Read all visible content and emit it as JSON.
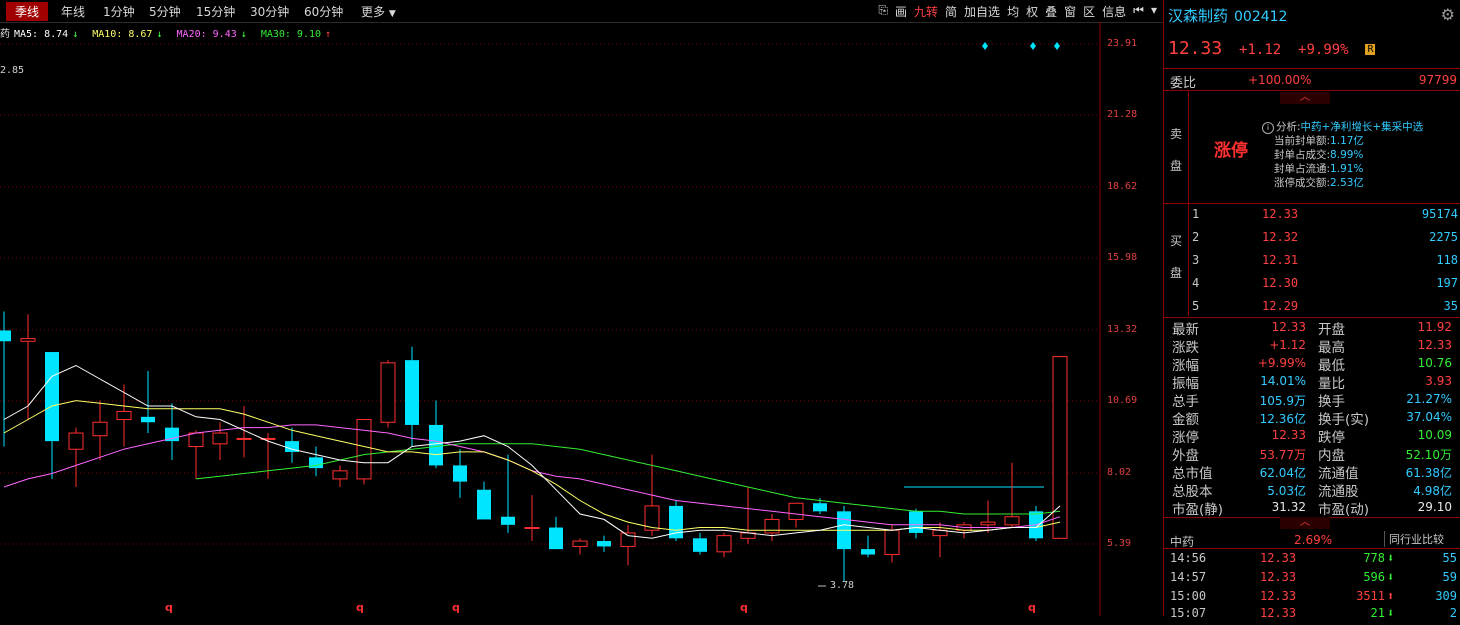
{
  "toolbar": {
    "periods": [
      "季线",
      "年线",
      "1分钟",
      "5分钟",
      "15分钟",
      "30分钟",
      "60分钟",
      "更多"
    ],
    "tools": [
      "⎘",
      "画",
      "九转",
      "简",
      "加自选",
      "均",
      "权",
      "叠",
      "窗",
      "区",
      "信息",
      "⏮",
      "▾"
    ]
  },
  "legend": {
    "prefix": "药",
    "ma5": "MA5: 8.74",
    "ma5_dir": "↓",
    "ma10": "MA10: 8.67",
    "ma10_dir": "↓",
    "ma20": "MA20: 9.43",
    "ma20_dir": "↓",
    "ma30": "MA30: 9.10",
    "ma30_dir": "↑"
  },
  "chart": {
    "high_label": "2.85",
    "low_label": "3.78",
    "axis_ticks": [
      "23.91",
      "21.28",
      "18.62",
      "15.98",
      "13.32",
      "10.69",
      "8.02",
      "5.39"
    ],
    "quarter_marks": [
      "q",
      "q",
      "q",
      "q",
      "q"
    ],
    "colors": {
      "up": "#ff3030",
      "down": "#00e5ff",
      "ma5": "#ffffff",
      "ma10": "#ffff66",
      "ma20": "#ff66ff",
      "ma30": "#33ee33",
      "grid": "#7a0000"
    }
  },
  "chart_data": {
    "type": "candlestick",
    "y_axis_ticks": [
      23.91,
      21.28,
      18.62,
      15.98,
      13.32,
      10.69,
      8.02,
      5.39
    ],
    "ylim": [
      5.39,
      23.91
    ],
    "candles": [
      {
        "o": 13.3,
        "h": 14.0,
        "l": 9.0,
        "c": 12.9
      },
      {
        "o": 12.9,
        "h": 13.9,
        "l": 10.0,
        "c": 13.0
      },
      {
        "o": 12.5,
        "h": 12.5,
        "l": 7.8,
        "c": 9.2
      },
      {
        "o": 8.9,
        "h": 9.7,
        "l": 7.5,
        "c": 9.5
      },
      {
        "o": 9.4,
        "h": 10.7,
        "l": 8.5,
        "c": 9.9
      },
      {
        "o": 10.0,
        "h": 11.3,
        "l": 9.0,
        "c": 10.3
      },
      {
        "o": 10.1,
        "h": 11.8,
        "l": 9.5,
        "c": 9.9
      },
      {
        "o": 9.7,
        "h": 10.6,
        "l": 8.5,
        "c": 9.2
      },
      {
        "o": 9.0,
        "h": 9.6,
        "l": 7.8,
        "c": 9.5
      },
      {
        "o": 9.1,
        "h": 9.9,
        "l": 8.5,
        "c": 9.5
      },
      {
        "o": 9.3,
        "h": 10.5,
        "l": 8.6,
        "c": 9.3
      },
      {
        "o": 9.3,
        "h": 9.5,
        "l": 7.8,
        "c": 9.3
      },
      {
        "o": 9.2,
        "h": 9.7,
        "l": 8.4,
        "c": 8.8
      },
      {
        "o": 8.6,
        "h": 9.0,
        "l": 7.9,
        "c": 8.2
      },
      {
        "o": 7.8,
        "h": 8.3,
        "l": 7.5,
        "c": 8.1
      },
      {
        "o": 7.8,
        "h": 10.0,
        "l": 7.6,
        "c": 10.0
      },
      {
        "o": 9.9,
        "h": 12.2,
        "l": 9.7,
        "c": 12.1
      },
      {
        "o": 12.2,
        "h": 12.7,
        "l": 9.0,
        "c": 9.8
      },
      {
        "o": 9.8,
        "h": 10.7,
        "l": 8.2,
        "c": 8.3
      },
      {
        "o": 8.3,
        "h": 8.9,
        "l": 7.1,
        "c": 7.7
      },
      {
        "o": 7.4,
        "h": 7.7,
        "l": 6.3,
        "c": 6.3
      },
      {
        "o": 6.4,
        "h": 8.7,
        "l": 5.8,
        "c": 6.1
      },
      {
        "o": 6.0,
        "h": 7.2,
        "l": 5.5,
        "c": 6.0
      },
      {
        "o": 6.0,
        "h": 6.4,
        "l": 5.2,
        "c": 5.2
      },
      {
        "o": 5.3,
        "h": 5.6,
        "l": 5.0,
        "c": 5.5
      },
      {
        "o": 5.5,
        "h": 5.7,
        "l": 5.1,
        "c": 5.3
      },
      {
        "o": 5.3,
        "h": 6.1,
        "l": 4.6,
        "c": 5.8
      },
      {
        "o": 5.9,
        "h": 8.7,
        "l": 5.7,
        "c": 6.8
      },
      {
        "o": 6.8,
        "h": 7.0,
        "l": 5.5,
        "c": 5.6
      },
      {
        "o": 5.6,
        "h": 5.8,
        "l": 5.0,
        "c": 5.1
      },
      {
        "o": 5.1,
        "h": 5.8,
        "l": 4.9,
        "c": 5.7
      },
      {
        "o": 5.6,
        "h": 7.5,
        "l": 5.4,
        "c": 5.8
      },
      {
        "o": 5.8,
        "h": 6.5,
        "l": 5.5,
        "c": 6.3
      },
      {
        "o": 6.3,
        "h": 6.9,
        "l": 6.0,
        "c": 6.9
      },
      {
        "o": 6.9,
        "h": 7.1,
        "l": 6.5,
        "c": 6.6
      },
      {
        "o": 6.6,
        "h": 6.8,
        "l": 4.0,
        "c": 5.2
      },
      {
        "o": 5.2,
        "h": 5.7,
        "l": 4.9,
        "c": 5.0
      },
      {
        "o": 5.0,
        "h": 6.1,
        "l": 4.7,
        "c": 5.9
      },
      {
        "o": 6.6,
        "h": 6.7,
        "l": 5.6,
        "c": 5.8
      },
      {
        "o": 5.7,
        "h": 6.2,
        "l": 4.9,
        "c": 5.9
      },
      {
        "o": 5.9,
        "h": 6.2,
        "l": 5.6,
        "c": 6.1
      },
      {
        "o": 6.1,
        "h": 7.0,
        "l": 5.8,
        "c": 6.2
      },
      {
        "o": 6.1,
        "h": 8.4,
        "l": 6.0,
        "c": 6.4
      },
      {
        "o": 6.6,
        "h": 6.8,
        "l": 5.5,
        "c": 5.6
      },
      {
        "o": 5.6,
        "h": 12.33,
        "l": 5.6,
        "c": 12.33
      }
    ],
    "ma5": [
      10.0,
      10.5,
      11.6,
      12.0,
      11.5,
      11.0,
      10.5,
      10.5,
      10.1,
      10.0,
      9.6,
      9.2,
      8.9,
      8.7,
      8.5,
      8.4,
      8.4,
      9.0,
      9.1,
      9.2,
      9.4,
      9.0,
      8.3,
      7.4,
      6.5,
      6.3,
      5.7,
      5.6,
      5.8,
      5.9,
      5.9,
      5.8,
      5.7,
      5.8,
      5.9,
      6.1,
      6.0,
      5.9,
      6.0,
      5.9,
      5.8,
      5.9,
      6.0,
      6.0,
      6.8
    ],
    "ma10": [
      9.5,
      10.0,
      10.5,
      10.7,
      10.6,
      10.5,
      10.4,
      10.4,
      10.4,
      10.4,
      10.2,
      9.9,
      9.6,
      9.4,
      9.2,
      9.0,
      8.8,
      8.8,
      8.7,
      8.8,
      8.8,
      8.5,
      8.1,
      7.6,
      7.0,
      6.5,
      6.2,
      6.0,
      5.9,
      6.0,
      6.0,
      5.9,
      5.9,
      5.9,
      5.9,
      5.9,
      5.9,
      5.9,
      6.0,
      6.0,
      5.9,
      5.9,
      6.0,
      6.0,
      6.2
    ],
    "ma20": [
      7.5,
      7.8,
      8.0,
      8.3,
      8.6,
      8.9,
      9.1,
      9.3,
      9.5,
      9.6,
      9.7,
      9.7,
      9.8,
      9.8,
      9.7,
      9.6,
      9.5,
      9.3,
      9.2,
      9.0,
      8.8,
      8.5,
      8.1,
      7.9,
      7.8,
      7.6,
      7.4,
      7.2,
      7.0,
      6.9,
      6.8,
      6.7,
      6.6,
      6.5,
      6.4,
      6.3,
      6.2,
      6.1,
      6.1,
      6.1,
      6.0,
      6.0,
      6.0,
      6.1,
      6.4
    ],
    "ma30": [
      null,
      null,
      null,
      null,
      null,
      null,
      null,
      null,
      7.8,
      7.9,
      8.0,
      8.1,
      8.2,
      8.3,
      8.5,
      8.7,
      8.8,
      8.9,
      9.0,
      9.1,
      9.1,
      9.1,
      9.1,
      9.0,
      8.9,
      8.7,
      8.5,
      8.3,
      8.1,
      7.9,
      7.7,
      7.5,
      7.3,
      7.1,
      7.0,
      6.9,
      6.8,
      6.7,
      6.6,
      6.6,
      6.5,
      6.5,
      6.5,
      6.5,
      6.6
    ],
    "flat_line": 7.5
  },
  "panel": {
    "name": "汉森制药",
    "code": "002412",
    "price": "12.33",
    "change": "+1.12",
    "change_pct": "+9.99%",
    "badge": "R",
    "weibi_label": "委比",
    "weibi_pct": "+100.00%",
    "weibi_vol": "97799",
    "sell_label": [
      "卖",
      "盘"
    ],
    "buy_label": [
      "买",
      "盘"
    ],
    "zt_label": "涨停",
    "analysis": {
      "title": "分析:",
      "tags": "中药+净利增长+集采中选",
      "rows": [
        {
          "k": "当前封单额:",
          "v": "1.17亿"
        },
        {
          "k": "封单占成交:",
          "v": "8.99%"
        },
        {
          "k": "封单占流通:",
          "v": "1.91%"
        },
        {
          "k": "涨停成交额:",
          "v": "2.53亿"
        }
      ]
    },
    "bids": [
      {
        "level": "1",
        "price": "12.33",
        "vol": "95174"
      },
      {
        "level": "2",
        "price": "12.32",
        "vol": "2275"
      },
      {
        "level": "3",
        "price": "12.31",
        "vol": "118"
      },
      {
        "level": "4",
        "price": "12.30",
        "vol": "197"
      },
      {
        "level": "5",
        "price": "12.29",
        "vol": "35"
      }
    ],
    "stats_left": [
      {
        "k": "最新",
        "v": "12.33",
        "c": "red"
      },
      {
        "k": "涨跌",
        "v": "+1.12",
        "c": "red"
      },
      {
        "k": "涨幅",
        "v": "+9.99%",
        "c": "red"
      },
      {
        "k": "振幅",
        "v": "14.01%",
        "c": "cyan"
      },
      {
        "k": "总手",
        "v": "105.9万",
        "c": "cyan"
      },
      {
        "k": "金额",
        "v": "12.36亿",
        "c": "cyan"
      },
      {
        "k": "涨停",
        "v": "12.33",
        "c": "red"
      },
      {
        "k": "外盘",
        "v": "53.77万",
        "c": "red"
      },
      {
        "k": "总市值",
        "v": "62.04亿",
        "c": "cyan"
      },
      {
        "k": "总股本",
        "v": "5.03亿",
        "c": "cyan"
      },
      {
        "k": "市盈(静)",
        "v": "31.32",
        "c": "white"
      }
    ],
    "stats_right": [
      {
        "k": "开盘",
        "v": "11.92",
        "c": "red"
      },
      {
        "k": "最高",
        "v": "12.33",
        "c": "red"
      },
      {
        "k": "最低",
        "v": "10.76",
        "c": "green"
      },
      {
        "k": "量比",
        "v": "3.93",
        "c": "red"
      },
      {
        "k": "换手",
        "v": "21.27%",
        "c": "cyan"
      },
      {
        "k": "换手(实)",
        "v": "37.04%",
        "c": "cyan"
      },
      {
        "k": "跌停",
        "v": "10.09",
        "c": "green"
      },
      {
        "k": "内盘",
        "v": "52.10万",
        "c": "green"
      },
      {
        "k": "流通值",
        "v": "61.38亿",
        "c": "cyan"
      },
      {
        "k": "流通股",
        "v": "4.98亿",
        "c": "cyan"
      },
      {
        "k": "市盈(动)",
        "v": "29.10",
        "c": "white"
      }
    ],
    "sector": "中药",
    "sector_pct": "2.69%",
    "compare": "同行业比较",
    "ticks": [
      {
        "t": "14:56",
        "p": "12.33",
        "v": "778",
        "dir": "down",
        "n": "55"
      },
      {
        "t": "14:57",
        "p": "12.33",
        "v": "596",
        "dir": "down",
        "n": "59"
      },
      {
        "t": "15:00",
        "p": "12.33",
        "v": "3511",
        "dir": "up",
        "n": "309"
      },
      {
        "t": "15:07",
        "p": "12.33",
        "v": "21",
        "dir": "down",
        "n": "2"
      }
    ]
  }
}
